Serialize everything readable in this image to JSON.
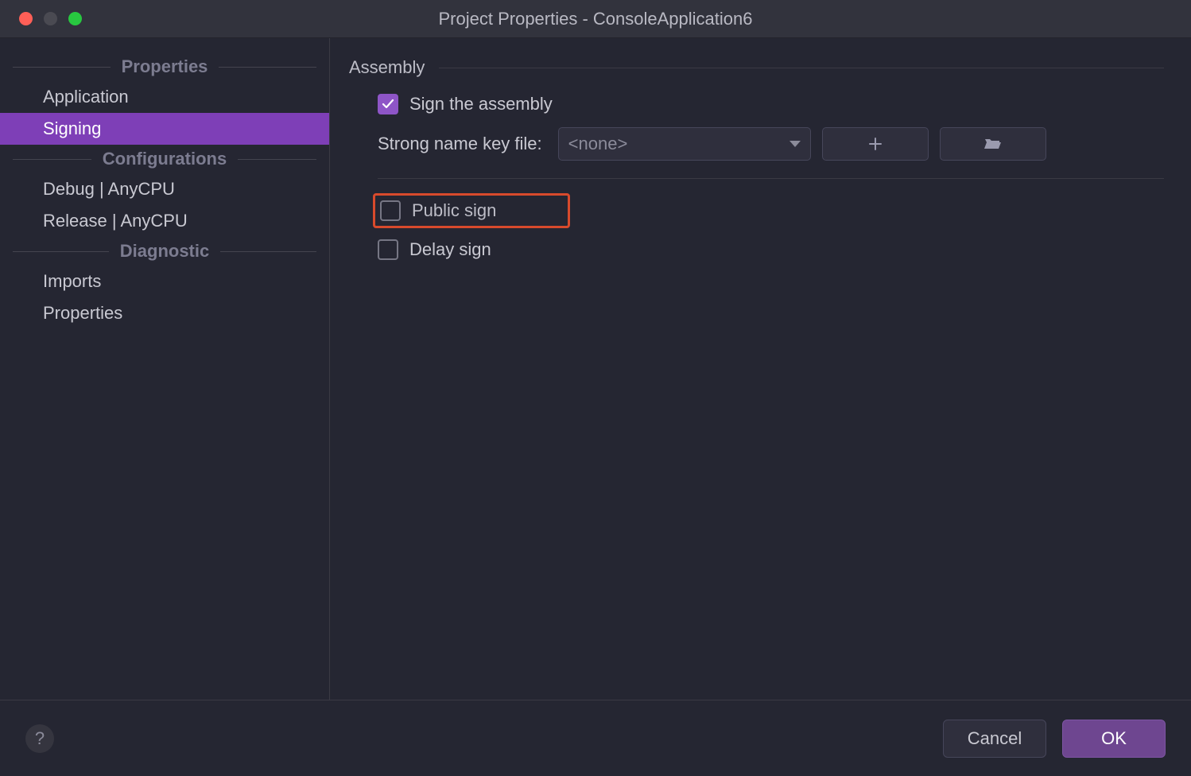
{
  "window": {
    "title": "Project Properties - ConsoleApplication6"
  },
  "sidebar": {
    "groups": [
      {
        "header": "Properties",
        "items": [
          {
            "label": "Application",
            "active": false
          },
          {
            "label": "Signing",
            "active": true
          }
        ]
      },
      {
        "header": "Configurations",
        "items": [
          {
            "label": "Debug | AnyCPU",
            "active": false
          },
          {
            "label": "Release | AnyCPU",
            "active": false
          }
        ]
      },
      {
        "header": "Diagnostic",
        "items": [
          {
            "label": "Imports",
            "active": false
          },
          {
            "label": "Properties",
            "active": false
          }
        ]
      }
    ]
  },
  "content": {
    "section_title": "Assembly",
    "sign_assembly": {
      "label": "Sign the assembly",
      "checked": true
    },
    "key_file": {
      "label": "Strong name key file:",
      "value": "<none>"
    },
    "public_sign": {
      "label": "Public sign",
      "checked": false
    },
    "delay_sign": {
      "label": "Delay sign",
      "checked": false
    }
  },
  "footer": {
    "help": "?",
    "cancel": "Cancel",
    "ok": "OK"
  }
}
